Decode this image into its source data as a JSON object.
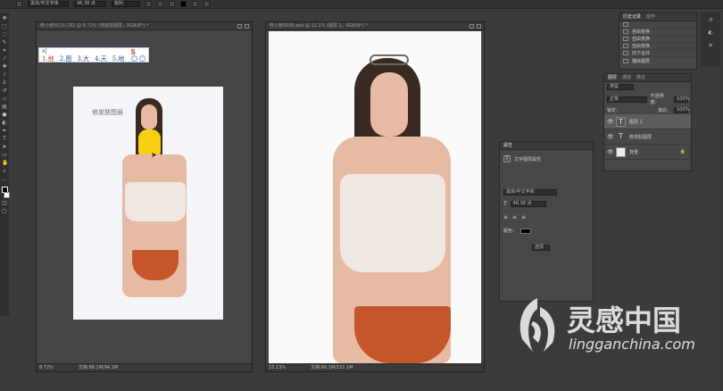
{
  "options_bar": {
    "font_family": "黑体/中文字体",
    "font_size": "46.38 点",
    "aa_mode": "锐利"
  },
  "tools": [
    "move",
    "marquee",
    "lasso",
    "quick-select",
    "crop",
    "eyedropper",
    "healing",
    "brush",
    "stamp",
    "history-brush",
    "eraser",
    "gradient",
    "blur",
    "dodge",
    "pen",
    "type",
    "path-select",
    "shape",
    "hand",
    "zoom",
    "more"
  ],
  "doc_left": {
    "title": "修小册5023.CR2 @ 8.72% (修皮肤图层，RGB/8*) *",
    "zoom": "8.72%",
    "doc_info": "文档:86.1M/94.1M",
    "canvas_text": "修皮肤图层"
  },
  "doc_right": {
    "title": "修小册5006.psd @ 11.1% (图层 1，RGB/8*) *",
    "zoom": "15.13%",
    "doc_info": "文档:86.1M/151.1M"
  },
  "ime": {
    "input": "x|",
    "candidates": [
      "1.他",
      "2.图",
      "3.大",
      "4.天",
      "5.地"
    ],
    "logo": "S"
  },
  "history_panel": {
    "tabs": [
      "历史记录",
      "动作"
    ],
    "items": [
      "",
      "自由变换",
      "自由变换",
      "自由变换",
      "向下合并",
      "描绘图层"
    ]
  },
  "layers_panel": {
    "tabs": [
      "图层",
      "通道",
      "路径"
    ],
    "filter_label": "类型",
    "blend_mode": "正常",
    "opacity_label": "不透明度：",
    "opacity": "100%",
    "lock_label": "锁定：",
    "fill_label": "填充：",
    "fill": "100%",
    "layers": [
      {
        "name": "图层 1",
        "thumb": "T",
        "selected": true
      },
      {
        "name": "修皮肤图层",
        "thumb": "T",
        "selected": false
      },
      {
        "name": "背景",
        "thumb": "img",
        "selected": false
      }
    ]
  },
  "char_panel": {
    "tab": "属性",
    "section": "文字图层属性",
    "font_family": "黑体/中文字体",
    "font_size": "46.38 点",
    "color_label": "颜色：",
    "button": "选项"
  },
  "watermark": {
    "cn": "灵感中国",
    "en": "lingganchina.com"
  }
}
